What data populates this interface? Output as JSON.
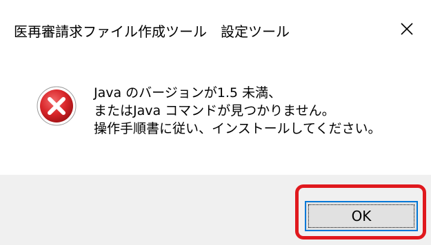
{
  "window": {
    "title": "医再審請求ファイル作成ツール　設定ツール",
    "close_icon": "close-icon"
  },
  "dialog": {
    "icon": "error-icon",
    "message_lines": [
      "Java のバージョンが1.5 未満、",
      "またはJava コマンドが見つかりません。",
      "操作手順書に従い、インストールしてください。"
    ],
    "ok_label": "OK"
  },
  "colors": {
    "error_red": "#d9262a",
    "highlight_red": "#e0191e",
    "button_focus_blue": "#0078d7",
    "footer_bg": "#f0f0f0"
  }
}
